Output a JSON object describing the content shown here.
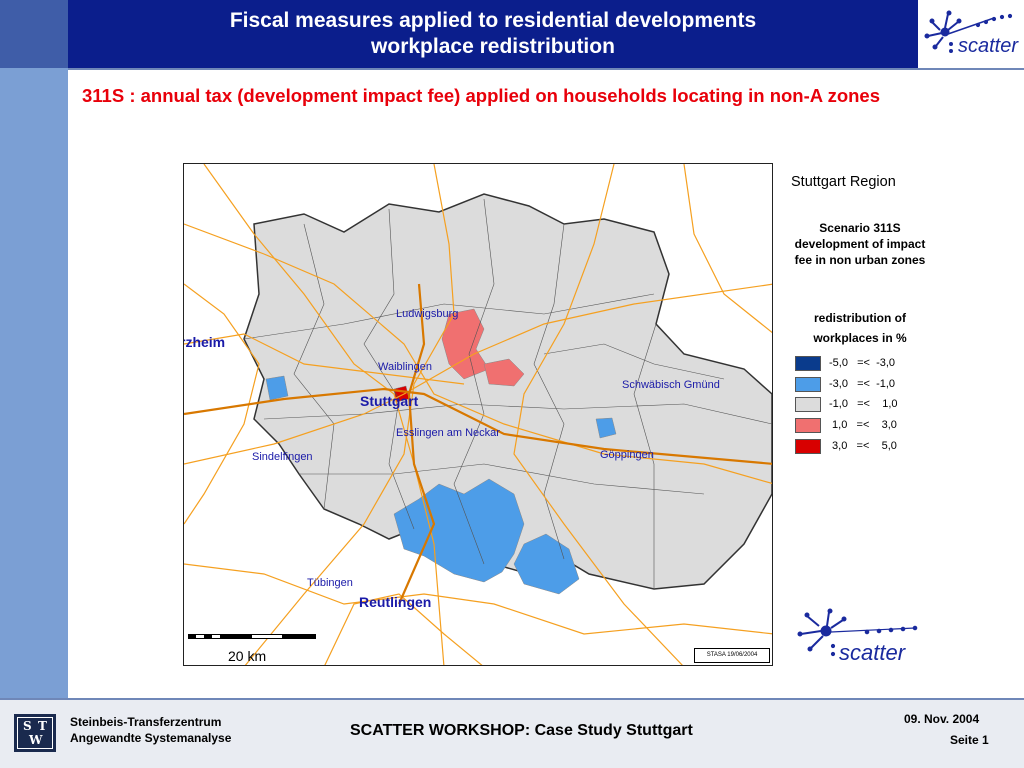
{
  "header": {
    "title_line1": "Fiscal measures applied to residential developments",
    "title_line2": "workplace redistribution",
    "logo_text": "scatter"
  },
  "subtitle": "311S : annual tax (development impact fee) applied on households locating in non-A zones",
  "map": {
    "cities": {
      "pforzheim": "rzheim",
      "ludwigsburg": "Ludwigsburg",
      "waiblingen": "Waiblingen",
      "schwaebisch_gmuend": "Schwäbisch Gmünd",
      "stuttgart": "Stuttgart",
      "esslingen": "Esslingen am Neckar",
      "sindelfingen": "Sindelfingen",
      "goeppingen": "Göppingen",
      "tuebingen": "Tübingen",
      "reutlingen": "Reutlingen"
    },
    "scale_label": "20 km",
    "stamp": "STASA 19/06/2004"
  },
  "legend": {
    "region": "Stuttgart Region",
    "scenario_line1": "Scenario 311S",
    "scenario_line2": "development of impact",
    "scenario_line3": "fee in non urban zones",
    "redistribution_line1": "redistribution of",
    "redistribution_line2": "workplaces in %",
    "classes": [
      {
        "label": "-5,0   =<  -3,0",
        "color": "#0a3b8c"
      },
      {
        "label": "-3,0   =<  -1,0",
        "color": "#4d9de8"
      },
      {
        "label": "-1,0   =<    1,0",
        "color": "#dcdcdc"
      },
      {
        "label": " 1,0   =<    3,0",
        "color": "#f07070"
      },
      {
        "label": " 3,0   =<    5,0",
        "color": "#d80000"
      }
    ]
  },
  "footer": {
    "logo_letters": [
      "S",
      "T",
      "W"
    ],
    "org_line1": "Steinbeis-Transferzentrum",
    "org_line2": "Angewandte Systemanalyse",
    "workshop": "SCATTER WORKSHOP: Case Study Stuttgart",
    "date": "09. Nov.  2004",
    "page": "Seite 1"
  }
}
